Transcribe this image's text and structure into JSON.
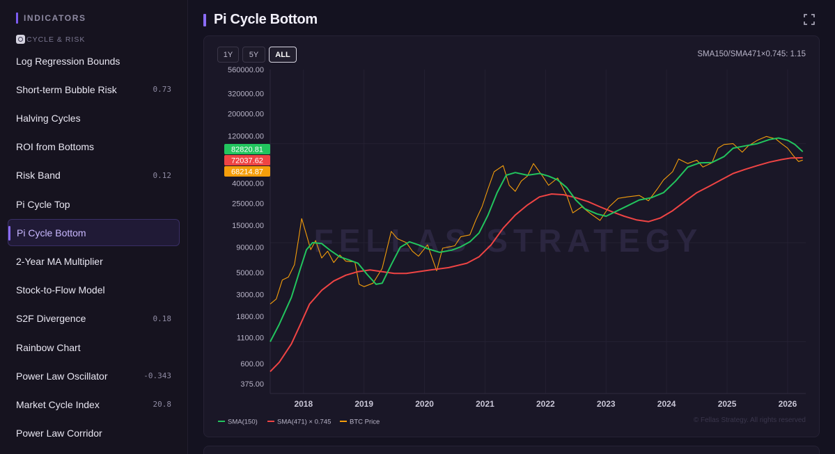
{
  "sidebar": {
    "header": "INDICATORS",
    "category": "CYCLE & RISK",
    "items": [
      {
        "label": "Log Regression Bounds",
        "value": ""
      },
      {
        "label": "Short-term Bubble Risk",
        "value": "0.73"
      },
      {
        "label": "Halving Cycles",
        "value": ""
      },
      {
        "label": "ROI from Bottoms",
        "value": ""
      },
      {
        "label": "Risk Band",
        "value": "0.12"
      },
      {
        "label": "Pi Cycle Top",
        "value": ""
      },
      {
        "label": "Pi Cycle Bottom",
        "value": "",
        "active": true
      },
      {
        "label": "2-Year MA Multiplier",
        "value": ""
      },
      {
        "label": "Stock-to-Flow Model",
        "value": ""
      },
      {
        "label": "S2F Divergence",
        "value": "0.18"
      },
      {
        "label": "Rainbow Chart",
        "value": ""
      },
      {
        "label": "Power Law Oscillator",
        "value": "-0.343"
      },
      {
        "label": "Market Cycle Index",
        "value": "20.8"
      },
      {
        "label": "Power Law Corridor",
        "value": ""
      }
    ]
  },
  "main": {
    "title": "Pi Cycle Bottom",
    "range_buttons": [
      "1Y",
      "5Y",
      "ALL"
    ],
    "active_range": "ALL",
    "ratio_text": "SMA150/SMA471×0.745: 1.15",
    "watermark": "FELLAS STRATEGY",
    "copyright": "© Fellas Strategy. All rights reserved"
  },
  "chart_data": {
    "type": "line",
    "y_scale": "log",
    "ylim": [
      300,
      560000
    ],
    "y_ticks": [
      375,
      600,
      1100,
      1800,
      3000,
      5000,
      9000,
      15000,
      25000,
      40000,
      120000,
      200000,
      320000,
      560000
    ],
    "y_tick_labels": [
      "375.00",
      "600.00",
      "1100.00",
      "1800.00",
      "3000.00",
      "5000.00",
      "9000.00",
      "15000.00",
      "25000.00",
      "40000.00",
      "120000.00",
      "200000.00",
      "320000.00",
      "560000.00"
    ],
    "x_range": [
      2017.45,
      2026.3
    ],
    "x_ticks": [
      2018,
      2019,
      2020,
      2021,
      2022,
      2023,
      2024,
      2025,
      2026
    ],
    "x_tick_labels": [
      "2018",
      "2019",
      "2020",
      "2021",
      "2022",
      "2023",
      "2024",
      "2025",
      "2026"
    ],
    "grid": true,
    "legend_position": "bottom-left",
    "current_values": [
      {
        "label": "82820.81",
        "color": "#22c55e"
      },
      {
        "label": "72037.62",
        "color": "#ef4444"
      },
      {
        "label": "68214.87",
        "color": "#f59e0b"
      }
    ],
    "series": [
      {
        "name": "SMA(150)",
        "color": "#22c55e",
        "points": [
          [
            2017.45,
            1000
          ],
          [
            2017.6,
            1500
          ],
          [
            2017.8,
            2800
          ],
          [
            2017.95,
            5500
          ],
          [
            2018.05,
            8500
          ],
          [
            2018.15,
            10000
          ],
          [
            2018.3,
            9800
          ],
          [
            2018.45,
            8300
          ],
          [
            2018.6,
            7200
          ],
          [
            2018.75,
            6700
          ],
          [
            2018.9,
            6200
          ],
          [
            2019.05,
            4800
          ],
          [
            2019.2,
            3800
          ],
          [
            2019.3,
            3900
          ],
          [
            2019.45,
            6000
          ],
          [
            2019.6,
            9000
          ],
          [
            2019.75,
            10200
          ],
          [
            2019.9,
            9500
          ],
          [
            2020.05,
            8700
          ],
          [
            2020.25,
            8000
          ],
          [
            2020.45,
            8400
          ],
          [
            2020.6,
            9100
          ],
          [
            2020.75,
            10200
          ],
          [
            2020.9,
            12500
          ],
          [
            2021.05,
            19000
          ],
          [
            2021.2,
            32000
          ],
          [
            2021.35,
            48000
          ],
          [
            2021.5,
            51000
          ],
          [
            2021.7,
            48000
          ],
          [
            2021.9,
            50000
          ],
          [
            2022.05,
            47000
          ],
          [
            2022.2,
            43000
          ],
          [
            2022.35,
            36000
          ],
          [
            2022.5,
            27000
          ],
          [
            2022.65,
            22000
          ],
          [
            2022.85,
            19500
          ],
          [
            2023.0,
            18500
          ],
          [
            2023.15,
            20500
          ],
          [
            2023.35,
            23500
          ],
          [
            2023.55,
            27000
          ],
          [
            2023.75,
            28500
          ],
          [
            2023.95,
            32000
          ],
          [
            2024.15,
            42000
          ],
          [
            2024.35,
            58000
          ],
          [
            2024.55,
            64000
          ],
          [
            2024.75,
            64500
          ],
          [
            2024.95,
            74000
          ],
          [
            2025.1,
            90000
          ],
          [
            2025.3,
            95000
          ],
          [
            2025.5,
            100000
          ],
          [
            2025.7,
            110000
          ],
          [
            2025.85,
            114000
          ],
          [
            2026.0,
            108000
          ],
          [
            2026.12,
            98000
          ],
          [
            2026.25,
            82820.81
          ]
        ]
      },
      {
        "name": "SMA(471) × 0.745",
        "color": "#ef4444",
        "points": [
          [
            2017.45,
            500
          ],
          [
            2017.6,
            620
          ],
          [
            2017.8,
            950
          ],
          [
            2017.95,
            1500
          ],
          [
            2018.1,
            2400
          ],
          [
            2018.3,
            3300
          ],
          [
            2018.5,
            4100
          ],
          [
            2018.7,
            4700
          ],
          [
            2018.9,
            5100
          ],
          [
            2019.1,
            5300
          ],
          [
            2019.3,
            5100
          ],
          [
            2019.5,
            4900
          ],
          [
            2019.7,
            4900
          ],
          [
            2019.9,
            5100
          ],
          [
            2020.1,
            5300
          ],
          [
            2020.4,
            5600
          ],
          [
            2020.7,
            6200
          ],
          [
            2020.9,
            7200
          ],
          [
            2021.1,
            9500
          ],
          [
            2021.3,
            14000
          ],
          [
            2021.5,
            19000
          ],
          [
            2021.7,
            24000
          ],
          [
            2021.9,
            29000
          ],
          [
            2022.1,
            31000
          ],
          [
            2022.3,
            30500
          ],
          [
            2022.5,
            28500
          ],
          [
            2022.7,
            26000
          ],
          [
            2022.9,
            23000
          ],
          [
            2023.1,
            20500
          ],
          [
            2023.3,
            18500
          ],
          [
            2023.5,
            17000
          ],
          [
            2023.7,
            16300
          ],
          [
            2023.9,
            17800
          ],
          [
            2024.1,
            21000
          ],
          [
            2024.3,
            26000
          ],
          [
            2024.5,
            32000
          ],
          [
            2024.7,
            37000
          ],
          [
            2024.9,
            43000
          ],
          [
            2025.1,
            50000
          ],
          [
            2025.3,
            55000
          ],
          [
            2025.5,
            60000
          ],
          [
            2025.7,
            65000
          ],
          [
            2025.9,
            69000
          ],
          [
            2026.05,
            71500
          ],
          [
            2026.25,
            72037.62
          ]
        ]
      },
      {
        "name": "BTC Price",
        "color": "#f59e0b",
        "points": [
          [
            2017.45,
            2400
          ],
          [
            2017.55,
            2700
          ],
          [
            2017.65,
            4200
          ],
          [
            2017.75,
            4500
          ],
          [
            2017.85,
            6000
          ],
          [
            2017.92,
            11000
          ],
          [
            2017.97,
            17500
          ],
          [
            2018.05,
            12000
          ],
          [
            2018.12,
            8500
          ],
          [
            2018.2,
            10500
          ],
          [
            2018.3,
            7000
          ],
          [
            2018.4,
            8200
          ],
          [
            2018.5,
            6300
          ],
          [
            2018.6,
            7500
          ],
          [
            2018.7,
            6500
          ],
          [
            2018.85,
            6400
          ],
          [
            2018.92,
            3800
          ],
          [
            2019.0,
            3600
          ],
          [
            2019.15,
            3900
          ],
          [
            2019.3,
            5500
          ],
          [
            2019.45,
            13000
          ],
          [
            2019.55,
            11000
          ],
          [
            2019.7,
            10000
          ],
          [
            2019.8,
            8200
          ],
          [
            2019.9,
            7300
          ],
          [
            2020.05,
            9500
          ],
          [
            2020.2,
            5200
          ],
          [
            2020.3,
            8800
          ],
          [
            2020.5,
            9300
          ],
          [
            2020.6,
            11500
          ],
          [
            2020.75,
            12000
          ],
          [
            2020.85,
            17000
          ],
          [
            2020.95,
            23000
          ],
          [
            2021.05,
            35000
          ],
          [
            2021.15,
            52000
          ],
          [
            2021.3,
            60000
          ],
          [
            2021.4,
            38000
          ],
          [
            2021.5,
            33000
          ],
          [
            2021.6,
            42000
          ],
          [
            2021.7,
            47000
          ],
          [
            2021.8,
            63000
          ],
          [
            2021.95,
            47000
          ],
          [
            2022.05,
            38000
          ],
          [
            2022.2,
            45000
          ],
          [
            2022.35,
            30000
          ],
          [
            2022.45,
            20000
          ],
          [
            2022.6,
            23000
          ],
          [
            2022.75,
            19500
          ],
          [
            2022.9,
            16800
          ],
          [
            2023.05,
            23000
          ],
          [
            2023.2,
            28000
          ],
          [
            2023.35,
            29000
          ],
          [
            2023.55,
            30000
          ],
          [
            2023.7,
            26500
          ],
          [
            2023.85,
            35000
          ],
          [
            2023.95,
            43000
          ],
          [
            2024.1,
            52000
          ],
          [
            2024.2,
            70000
          ],
          [
            2024.35,
            63000
          ],
          [
            2024.5,
            68000
          ],
          [
            2024.6,
            58000
          ],
          [
            2024.75,
            64000
          ],
          [
            2024.85,
            90000
          ],
          [
            2024.95,
            98000
          ],
          [
            2025.1,
            100000
          ],
          [
            2025.25,
            82000
          ],
          [
            2025.35,
            95000
          ],
          [
            2025.5,
            108000
          ],
          [
            2025.65,
            118000
          ],
          [
            2025.8,
            112000
          ],
          [
            2025.9,
            100000
          ],
          [
            2026.0,
            90000
          ],
          [
            2026.1,
            75000
          ],
          [
            2026.18,
            66000
          ],
          [
            2026.25,
            68214.87
          ]
        ]
      }
    ]
  }
}
